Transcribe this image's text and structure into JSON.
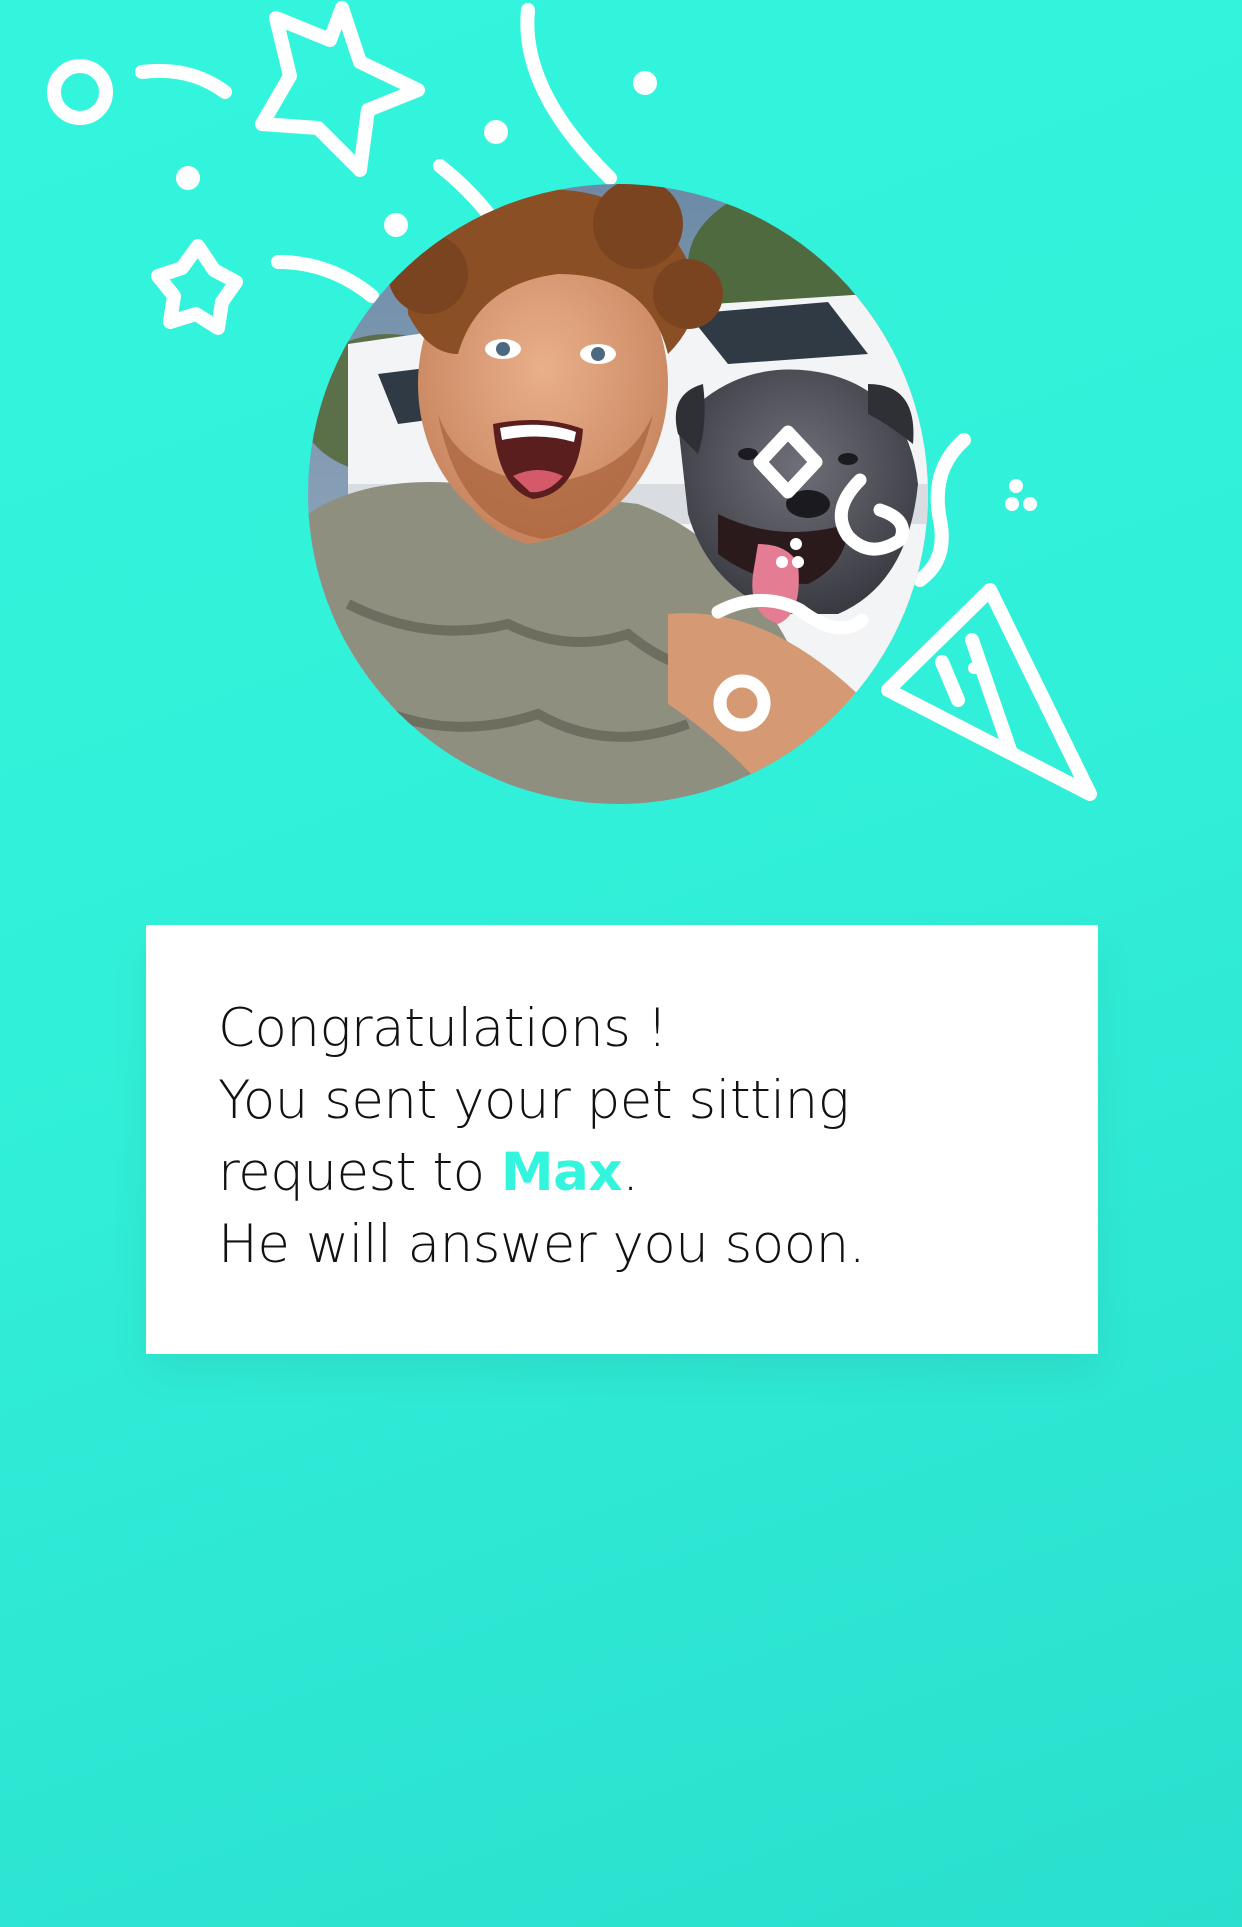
{
  "profile": {
    "photo_alt": "avatar photo"
  },
  "message": {
    "line1": "Congratulations !",
    "line2": "You sent your pet sitting",
    "line3_prefix": "request to ",
    "sitter_name": "Max",
    "line3_suffix": ".",
    "line4": "He will answer you soon."
  },
  "colors": {
    "background": "#33f5dd",
    "accent": "#33f5dd",
    "card": "#ffffff",
    "text": "#111111"
  },
  "icons": [
    "star-icon",
    "circle-icon",
    "party-hat-icon",
    "diamond-icon",
    "streamer-icon"
  ]
}
